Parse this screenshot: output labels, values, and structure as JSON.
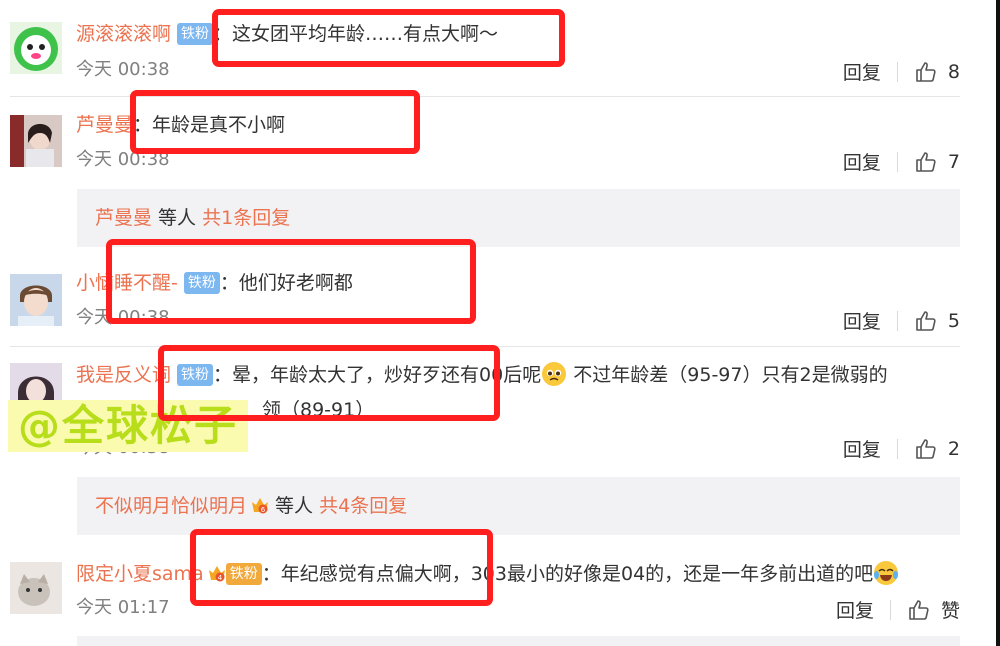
{
  "colors": {
    "username": "#eb7350",
    "badge": "#7cb7f0",
    "highlight": "#ff1f1f",
    "watermark_text": "#b8dd1a",
    "watermark_bg": "#fbfbb0"
  },
  "comments": [
    {
      "user": "源滚滚滚啊",
      "badge": "铁粉",
      "colon": "：",
      "text": "这女团平均年龄……有点大啊～",
      "time": "今天 00:38",
      "reply": "回复",
      "likes": "8"
    },
    {
      "user": "芦曼曼",
      "colon": "：",
      "text": "年龄是真不小啊",
      "time": "今天 00:38",
      "reply": "回复",
      "likes": "7"
    },
    {
      "user": "小恼睡不醒-",
      "badge": "铁粉",
      "colon": "：",
      "text": "他们好老啊都",
      "time": "今天 00:38",
      "reply": "回复",
      "likes": "5"
    },
    {
      "user": "我是反义词",
      "badge": "铁粉",
      "colon": "：",
      "text": "晕，年龄太大了，炒好歹还有00后呢",
      "text_cont": "不过年龄差（95-97）只有2是微弱的",
      "text2": "领（89-91）",
      "time": "今天 00:38",
      "reply": "回复",
      "likes": "2"
    },
    {
      "user": "限定小夏sama",
      "badge": "铁粉",
      "crown_level": "4",
      "colon": "：",
      "text": "年纪感觉有点偏大啊，303最小的好像是04的，还是一年多前出道的吧",
      "time": "今天 01:17",
      "reply": "回复",
      "likes": "赞"
    }
  ],
  "reply_summaries": [
    {
      "name": "芦曼曼",
      "middle": " 等人 ",
      "count": "共1条回复"
    },
    {
      "name": "不似明月恰似明月",
      "crown_level": "6",
      "middle": " 等人 ",
      "count": "共4条回复"
    }
  ],
  "watermark": "@全球松子",
  "icons": {
    "like": "thumbs-up-icon",
    "emoji_sad": "pleading-face-emoji",
    "emoji_laugh": "tears-of-joy-emoji",
    "crown": "crown-level-icon"
  }
}
